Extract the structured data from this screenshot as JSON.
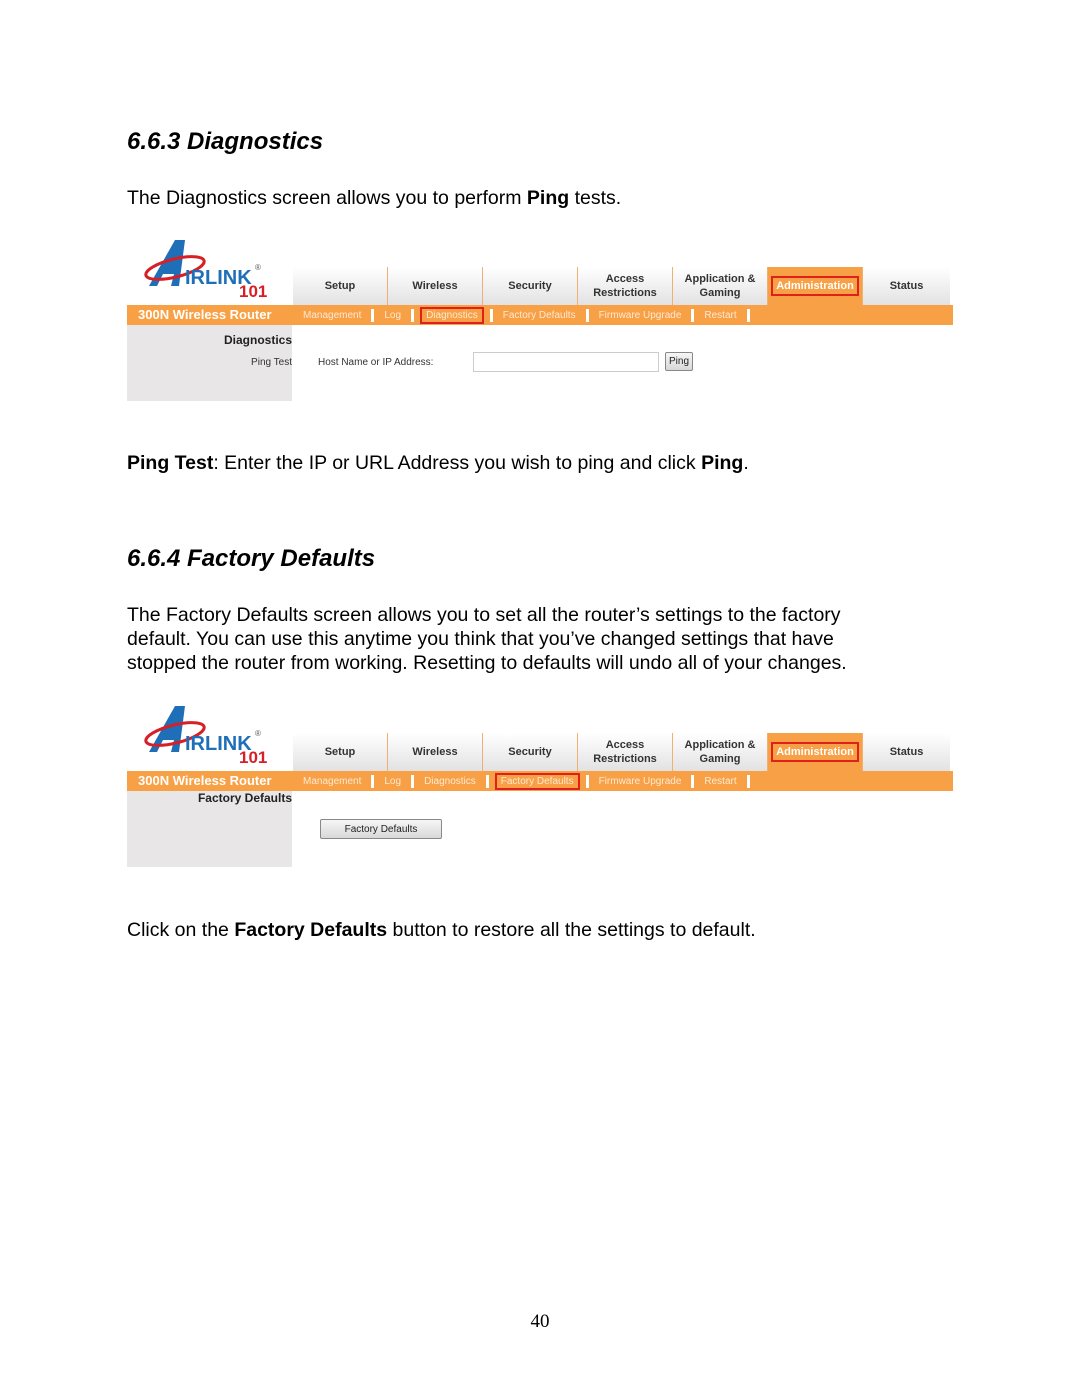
{
  "sections": [
    {
      "heading": "6.6.3 Diagnostics",
      "intro": {
        "pre": "The Diagnostics screen allows you to perform ",
        "bold": "Ping",
        "post": " tests."
      },
      "note": {
        "bold1": "Ping Test",
        "mid": ": Enter the IP or URL Address you wish to ping and click ",
        "bold2": "Ping",
        "post": "."
      }
    },
    {
      "heading": "6.6.4 Factory Defaults",
      "intro_lines": [
        "The Factory Defaults screen allows you to set all the router’s settings to the factory",
        "default.  You can use this anytime you think that you’ve changed settings that have",
        "stopped the router from working.  Resetting to defaults will undo all of your changes."
      ],
      "note": {
        "pre": "Click on the ",
        "bold": "Factory Defaults",
        "post": " button to restore all the settings to default."
      }
    }
  ],
  "router_ui": {
    "logo": {
      "text": "IRLINK",
      "number": "101",
      "registered": "®",
      "accent_blue": "#1f6fb8",
      "accent_red": "#d61f26"
    },
    "brand": "300N Wireless Router",
    "tabs": [
      {
        "label": "Setup"
      },
      {
        "label": "Wireless"
      },
      {
        "label": "Security"
      },
      {
        "label": "Access Restrictions"
      },
      {
        "label": "Application & Gaming"
      },
      {
        "label": "Administration",
        "active": true
      },
      {
        "label": "Status"
      }
    ],
    "subnav": [
      "Management",
      "Log",
      "Diagnostics",
      "Factory Defaults",
      "Firmware Upgrade",
      "Restart"
    ],
    "colors": {
      "orange": "#f7a046",
      "highlight": "#e0201a",
      "panel": "#e8e6e6"
    }
  },
  "screenshot1": {
    "active_subnav": "Diagnostics",
    "section_title": "Diagnostics",
    "sub_label": "Ping Test",
    "field_label": "Host Name or IP Address:",
    "field_value": "",
    "button_label": "Ping"
  },
  "screenshot2": {
    "active_subnav": "Factory Defaults",
    "section_title": "Factory Defaults",
    "button_label": "Factory Defaults"
  },
  "page_number": "40"
}
